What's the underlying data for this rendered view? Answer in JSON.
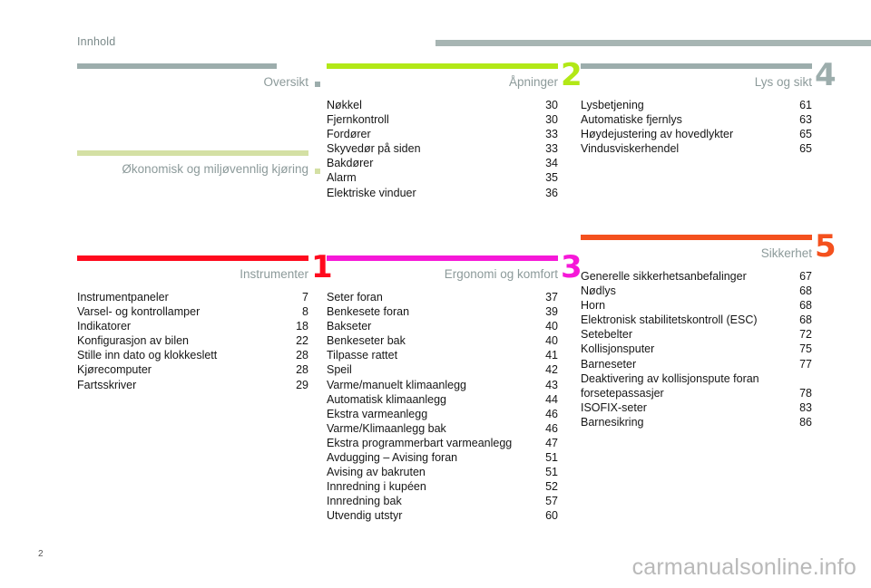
{
  "header": {
    "title": "Innhold",
    "rule_color": "#a7b5b3"
  },
  "footer": {
    "page_number": "2",
    "watermark": "carmanualsonline.info"
  },
  "sections": {
    "oversikt": {
      "title": "Oversikt",
      "number": "",
      "accent": "#9cadac",
      "entries": []
    },
    "okonomi": {
      "title": "Økonomisk og miljøvennlig kjøring",
      "number": "",
      "accent": "#d4e0a4",
      "entries": []
    },
    "instrumenter": {
      "title": "Instrumenter",
      "number": "1",
      "accent": "#ff0a1e",
      "entries": [
        {
          "label": "Instrumentpaneler",
          "page": "7"
        },
        {
          "label": "Varsel- og kontrollamper",
          "page": "8"
        },
        {
          "label": "Indikatorer",
          "page": "18"
        },
        {
          "label": "Konfigurasjon av bilen",
          "page": "22"
        },
        {
          "label": "Stille inn dato og klokkeslett",
          "page": "28"
        },
        {
          "label": "Kjørecomputer",
          "page": "28"
        },
        {
          "label": "Fartsskriver",
          "page": "29"
        }
      ]
    },
    "apninger": {
      "title": "Åpninger",
      "number": "2",
      "accent": "#b2e817",
      "entries": [
        {
          "label": "Nøkkel",
          "page": "30"
        },
        {
          "label": "Fjernkontroll",
          "page": "30"
        },
        {
          "label": "Fordører",
          "page": "33"
        },
        {
          "label": "Skyvedør på siden",
          "page": "33"
        },
        {
          "label": "Bakdører",
          "page": "34"
        },
        {
          "label": "Alarm",
          "page": "35"
        },
        {
          "label": "Elektriske vinduer",
          "page": "36"
        }
      ]
    },
    "ergonomi": {
      "title": "Ergonomi og komfort",
      "number": "3",
      "accent": "#f618d8",
      "entries": [
        {
          "label": "Seter foran",
          "page": "37"
        },
        {
          "label": "Benkesete foran",
          "page": "39"
        },
        {
          "label": "Bakseter",
          "page": "40"
        },
        {
          "label": "Benkeseter bak",
          "page": "40"
        },
        {
          "label": "Tilpasse rattet",
          "page": "41"
        },
        {
          "label": "Speil",
          "page": "42"
        },
        {
          "label": "Varme/manuelt klimaanlegg",
          "page": "43"
        },
        {
          "label": "Automatisk klimaanlegg",
          "page": "44"
        },
        {
          "label": "Ekstra varmeanlegg",
          "page": "46"
        },
        {
          "label": "Varme/Klimaanlegg bak",
          "page": "46"
        },
        {
          "label": "Ekstra programmerbart varmeanlegg",
          "page": "47"
        },
        {
          "label": "Avdugging – Avising foran",
          "page": "51"
        },
        {
          "label": "Avising av bakruten",
          "page": "51"
        },
        {
          "label": "Innredning i kupéen",
          "page": "52"
        },
        {
          "label": "Innredning bak",
          "page": "57"
        },
        {
          "label": "Utvendig utstyr",
          "page": "60"
        }
      ]
    },
    "lys": {
      "title": "Lys og sikt",
      "number": "4",
      "accent": "#9cadac",
      "entries": [
        {
          "label": "Lysbetjening",
          "page": "61"
        },
        {
          "label": "Automatiske fjernlys",
          "page": "63"
        },
        {
          "label": "Høydejustering av hovedlykter",
          "page": "65"
        },
        {
          "label": "Vindusviskerhendel",
          "page": "65"
        }
      ]
    },
    "sikkerhet": {
      "title": "Sikkerhet",
      "number": "5",
      "accent": "#f4511e",
      "entries": [
        {
          "label": "Generelle sikkerhetsanbefalinger",
          "page": "67"
        },
        {
          "label": "Nødlys",
          "page": "68"
        },
        {
          "label": "Horn",
          "page": "68"
        },
        {
          "label": "Elektronisk stabilitetskontroll (ESC)",
          "page": "68"
        },
        {
          "label": "Setebelter",
          "page": "72"
        },
        {
          "label": "Kollisjonsputer",
          "page": "75"
        },
        {
          "label": "Barneseter",
          "page": "77"
        },
        {
          "label": "Deaktivering av kollisjonspute foran\nforsetepassasjer",
          "page": "78"
        },
        {
          "label": "ISOFIX-seter",
          "page": "83"
        },
        {
          "label": "Barnesikring",
          "page": "86"
        }
      ]
    }
  }
}
